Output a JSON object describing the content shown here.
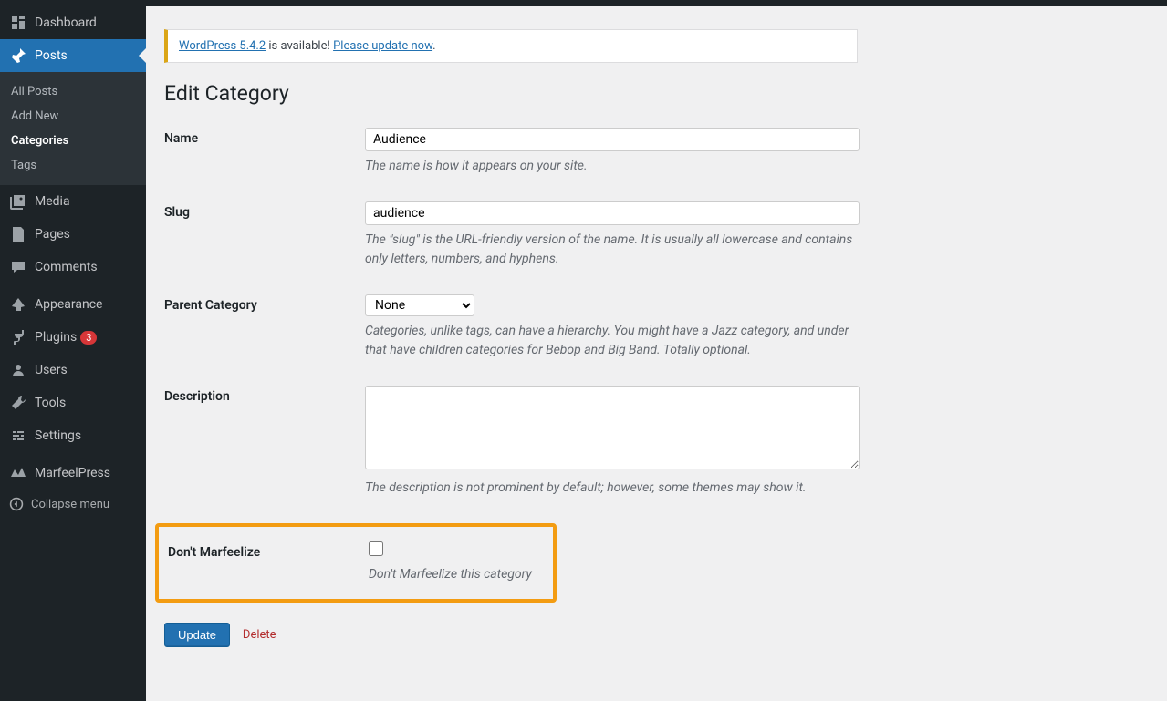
{
  "sidebar": {
    "items": [
      {
        "label": "Dashboard"
      },
      {
        "label": "Posts"
      },
      {
        "label": "Media"
      },
      {
        "label": "Pages"
      },
      {
        "label": "Comments"
      },
      {
        "label": "Appearance"
      },
      {
        "label": "Plugins",
        "badge": "3"
      },
      {
        "label": "Users"
      },
      {
        "label": "Tools"
      },
      {
        "label": "Settings"
      },
      {
        "label": "MarfeelPress"
      }
    ],
    "submenu": [
      {
        "label": "All Posts"
      },
      {
        "label": "Add New"
      },
      {
        "label": "Categories"
      },
      {
        "label": "Tags"
      }
    ],
    "collapse": "Collapse menu"
  },
  "notice": {
    "link1": "WordPress 5.4.2",
    "text": " is available! ",
    "link2": "Please update now",
    "period": "."
  },
  "page_title": "Edit Category",
  "form": {
    "name": {
      "label": "Name",
      "value": "Audience",
      "description": "The name is how it appears on your site."
    },
    "slug": {
      "label": "Slug",
      "value": "audience",
      "description": "The \"slug\" is the URL-friendly version of the name. It is usually all lowercase and contains only letters, numbers, and hyphens."
    },
    "parent": {
      "label": "Parent Category",
      "selected": "None",
      "description": "Categories, unlike tags, can have a hierarchy. You might have a Jazz category, and under that have children categories for Bebop and Big Band. Totally optional."
    },
    "description": {
      "label": "Description",
      "value": "",
      "description": "The description is not prominent by default; however, some themes may show it."
    },
    "marfeel": {
      "label": "Don't Marfeelize",
      "desc": "Don't Marfeelize this category"
    }
  },
  "actions": {
    "update": "Update",
    "delete": "Delete"
  }
}
